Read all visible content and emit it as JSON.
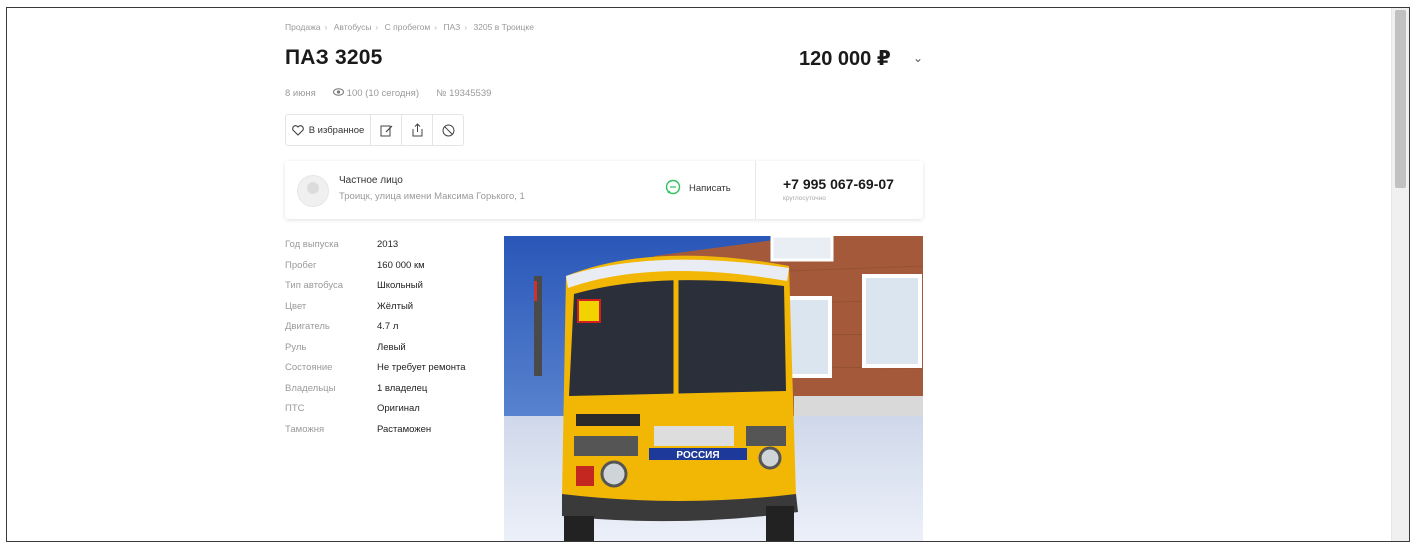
{
  "breadcrumb": [
    "Продажа",
    "Автобусы",
    "С пробегом",
    "ПАЗ",
    "3205 в Троицке"
  ],
  "listing": {
    "title": "ПАЗ 3205",
    "price": "120 000 ₽",
    "date": "8 июня",
    "views": "100 (10 сегодня)",
    "number": "№ 19345539"
  },
  "actions": {
    "favorite_label": "В избранное"
  },
  "seller": {
    "name": "Частное лицо",
    "address": "Троицк, улица имени Максима Горького, 1",
    "write_label": "Написать",
    "phone": "+7 995 067-69-07",
    "phone_note": "круглосуточно"
  },
  "specs": [
    {
      "key": "Год выпуска",
      "value": "2013"
    },
    {
      "key": "Пробег",
      "value": "160 000 км"
    },
    {
      "key": "Тип автобуса",
      "value": "Школьный"
    },
    {
      "key": "Цвет",
      "value": "Жёлтый"
    },
    {
      "key": "Двигатель",
      "value": "4.7 л"
    },
    {
      "key": "Руль",
      "value": "Левый"
    },
    {
      "key": "Состояние",
      "value": "Не требует ремонта"
    },
    {
      "key": "Владельцы",
      "value": "1 владелец"
    },
    {
      "key": "ПТС",
      "value": "Оригинал"
    },
    {
      "key": "Таможня",
      "value": "Растаможен"
    }
  ],
  "photo": {
    "bus_plate_text": "РОССИЯ"
  },
  "colors": {
    "accent_green": "#2fbf5e",
    "bus_yellow": "#f2b705"
  },
  "icons": [
    "heart-icon",
    "edit-icon",
    "share-icon",
    "block-icon",
    "eye-icon",
    "chat-icon",
    "chevron-down-icon"
  ]
}
